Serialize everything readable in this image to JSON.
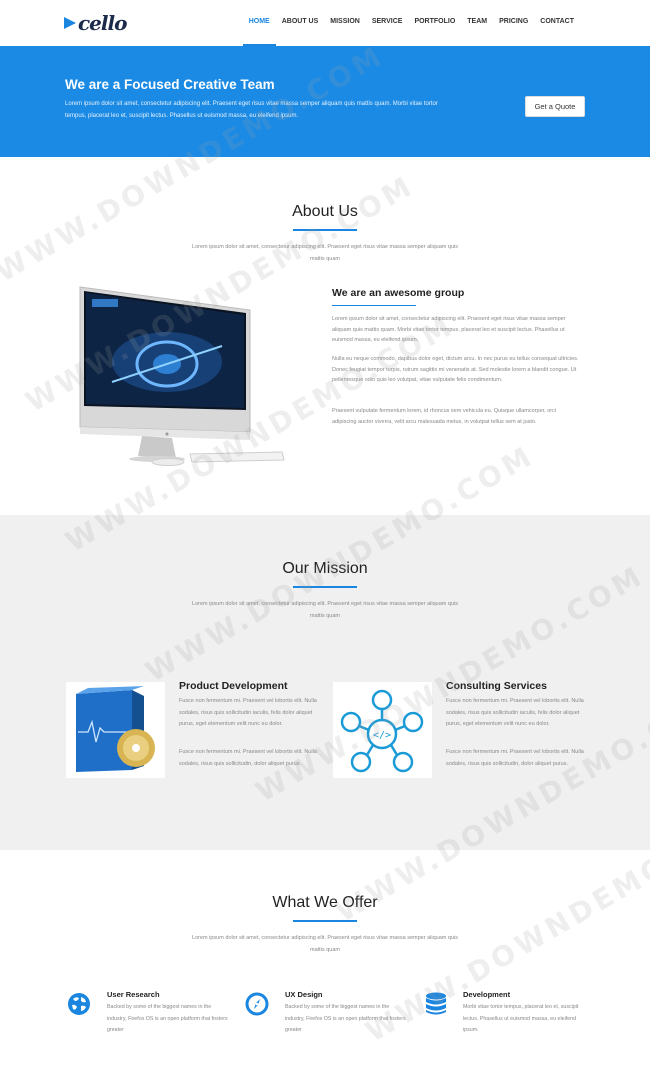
{
  "nav": {
    "logo": "cello",
    "links": [
      "HOME",
      "ABOUT US",
      "MISSION",
      "SERVICE",
      "PORTFOLIO",
      "TEAM",
      "PRICING",
      "CONTACT"
    ]
  },
  "hero": {
    "title": "We are a Focused Creative Team",
    "text": "Lorem ipsum dolor sit amet, consectetur adipiscing elit. Praesent eget risus vitae massa semper aliquam quis mattis quam. Morbi vitae tortor tempus, placerat leo et, suscipit lectus. Phasellus ut euismod massa, eu eleifend ipsum.",
    "button": "Get a Quote"
  },
  "about": {
    "title": "About Us",
    "subtitle": "Lorem ipsum dolor sit amet, consectetur adipiscing elit. Praesent eget risus vitae massa semper aliquam quis mattis quam",
    "heading": "We are an awesome group",
    "p1": "Lorem ipsum dolor sit amet, consectetur adipiscing elit. Praesent eget risus vitae massa semper aliquam quis mattis quam. Morbi vitae tortor tempus, placerat leo et suscipit lectus. Phasellus ut euismod massa, eu eleifend ipsum.",
    "p2": "Nulla eu neque commodo, dapibus dolor eget, dictum arcu. In nec purus eu tellus consequat ultricies. Donec feugiat tempor turpis, rutrum sagittis mi venenatis at. Sed molestie lorem a blandit congue. Ut pellentesque odio quis leo volutpat, vitae vulputate felis condimentum.",
    "p3": "Praesent vulputate fermentum lorem, id rhoncus sem vehicula eu. Quisque ullamcorper, orci adipiscing auctor viverra, velit arcu malesuada metus, in volutpat tellus sem at justo."
  },
  "mission": {
    "title": "Our Mission",
    "subtitle": "Lorem ipsum dolor sit amet, consectetur adipiscing elit. Praesent eget risus vitae massa semper aliquam quis mattis quam",
    "cards": [
      {
        "title": "Product Development",
        "p1": "Fusce non fermentum mi. Praesent vel lobortis elit. Nulla sodales, risus quis sollicitudin iaculis, felis dolor aliquet purus, eget elementum velit nunc eu dolor.",
        "p2": "Fusce non fermentum mi. Praesent vel lobortis elit. Nulla sodales, risus quis sollicitudin, dolor aliquet purus."
      },
      {
        "title": "Consulting Services",
        "p1": "Fusce non fermentum mi. Praesent vel lobortis elit. Nulla sodales, risus quis sollicitudin iaculis, felis dolor aliquet purus, eget elementum velit nunc eu dolor.",
        "p2": "Fusce non fermentum mi. Praesent vel lobortis elit. Nulla sodales, risus quis sollicitudin, dolor aliquet purus."
      }
    ]
  },
  "offer": {
    "title": "What We Offer",
    "subtitle": "Lorem ipsum dolor sit amet, consectetur adipiscing elit. Praesent eget risus vitae massa semper aliquam quis mattis quam",
    "items": [
      {
        "title": "User Research",
        "text": "Backed by some of the biggest names in the industry, Firefox OS is an open platform that fosters greater",
        "icon": "globe-icon"
      },
      {
        "title": "UX Design",
        "text": "Backed by some of the biggest names in the industry, Firefox OS is an open platform that fosters greater",
        "icon": "compass-icon"
      },
      {
        "title": "Development",
        "text": "Morbi vitae tortor tempus, placerat leo et, suscipit lectus. Phasellus ut euismod massa, eu eleifend ipsum.",
        "icon": "database-icon"
      }
    ]
  },
  "watermark": "WWW.DOWNDEMO.COM",
  "colors": {
    "accent": "#1a86e0",
    "hero_bg": "#1a8ae4",
    "mission_bg": "#f0f0f0"
  }
}
